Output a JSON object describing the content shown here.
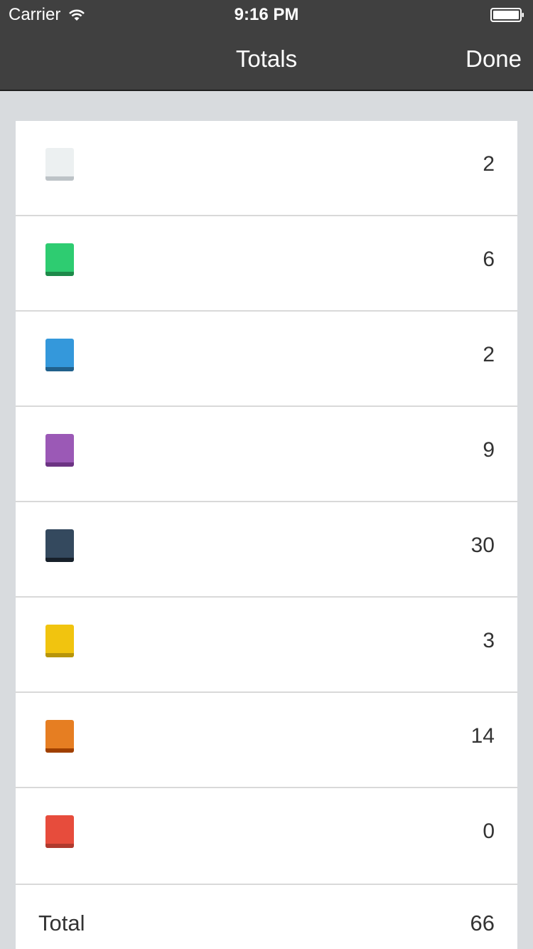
{
  "status_bar": {
    "carrier": "Carrier",
    "time": "9:16 PM"
  },
  "nav": {
    "title": "Totals",
    "done_label": "Done"
  },
  "rows": [
    {
      "color": "#ecf0f1",
      "shade": "#bdc3c7",
      "count": "2"
    },
    {
      "color": "#2ecc71",
      "shade": "#1e8a4a",
      "count": "6"
    },
    {
      "color": "#3498db",
      "shade": "#21618c",
      "count": "2"
    },
    {
      "color": "#9b59b6",
      "shade": "#6c3483",
      "count": "9"
    },
    {
      "color": "#34495e",
      "shade": "#17202a",
      "count": "30"
    },
    {
      "color": "#f1c40f",
      "shade": "#b7950b",
      "count": "3"
    },
    {
      "color": "#e67e22",
      "shade": "#a04000",
      "count": "14"
    },
    {
      "color": "#e74c3c",
      "shade": "#b03a2e",
      "count": "0"
    }
  ],
  "total": {
    "label": "Total",
    "value": "66"
  }
}
